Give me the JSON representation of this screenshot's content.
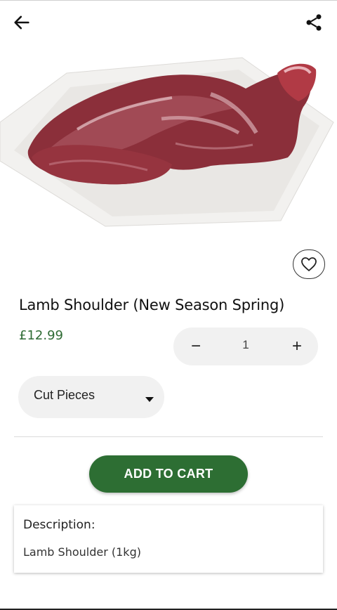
{
  "app_bar": {
    "back_icon": "arrow-left-icon",
    "share_icon": "share-icon"
  },
  "product": {
    "image_icon": "lamb-shoulder-photo",
    "favorite_icon": "heart-outline-icon",
    "title": "Lamb Shoulder (New Season Spring)",
    "price": "£12.99"
  },
  "quantity": {
    "minus_label": "−",
    "value": "1",
    "plus_label": "+"
  },
  "cut_option": {
    "selected": "Cut Pieces",
    "caret_icon": "caret-down-icon"
  },
  "actions": {
    "add_to_cart_label": "ADD TO CART"
  },
  "description": {
    "title": "Description:",
    "text": "Lamb Shoulder (1kg)"
  },
  "colors": {
    "accent": "#2d6e33",
    "price": "#2e6b34",
    "pill_bg": "#f1f1f1"
  }
}
